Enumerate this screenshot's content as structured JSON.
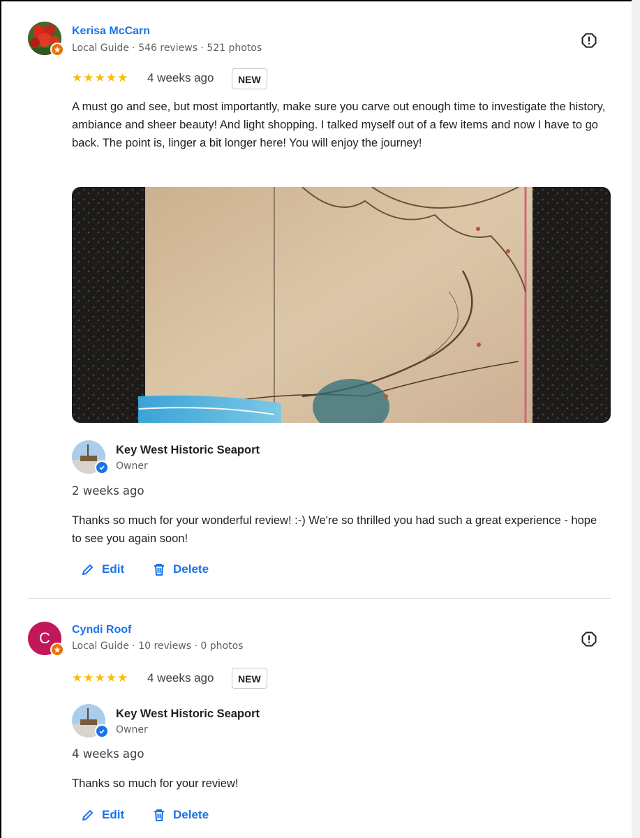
{
  "reviews": [
    {
      "author": "Kerisa McCarn",
      "meta": "Local Guide · 546 reviews · 521 photos",
      "stars": "★★★★★",
      "time": "4 weeks ago",
      "badge": "NEW",
      "text": "A must go and see, but most importantly, make sure you carve out enough time to investigate the history, ambiance and sheer beauty! And light shopping. I talked myself out of a few items and now I have to go back. The point is, linger a bit longer here! You will enjoy the journey!",
      "reply": {
        "owner_name": "Key West Historic Seaport",
        "owner_role": "Owner",
        "time": "2 weeks ago",
        "text": "Thanks so much for your wonderful review! :-) We're so thrilled you had such a great experience - hope to see you again soon!",
        "edit_label": "Edit",
        "delete_label": "Delete"
      }
    },
    {
      "author": "Cyndi Roof",
      "avatar_initial": "C",
      "meta": "Local Guide · 10 reviews · 0 photos",
      "stars": "★★★★★",
      "time": "4 weeks ago",
      "badge": "NEW",
      "reply": {
        "owner_name": "Key West Historic Seaport",
        "owner_role": "Owner",
        "time": "4 weeks ago",
        "text": "Thanks so much for your review!",
        "edit_label": "Edit",
        "delete_label": "Delete"
      }
    }
  ],
  "colors": {
    "link": "#1a73e8",
    "star": "#fbbc04",
    "guide_badge": "#e8710a",
    "avatar_c": "#c2185b",
    "verified": "#1a73e8"
  },
  "icons": [
    "flag-icon",
    "local-guide-badge-icon",
    "verified-badge-icon",
    "edit-pencil-icon",
    "delete-trash-icon"
  ]
}
